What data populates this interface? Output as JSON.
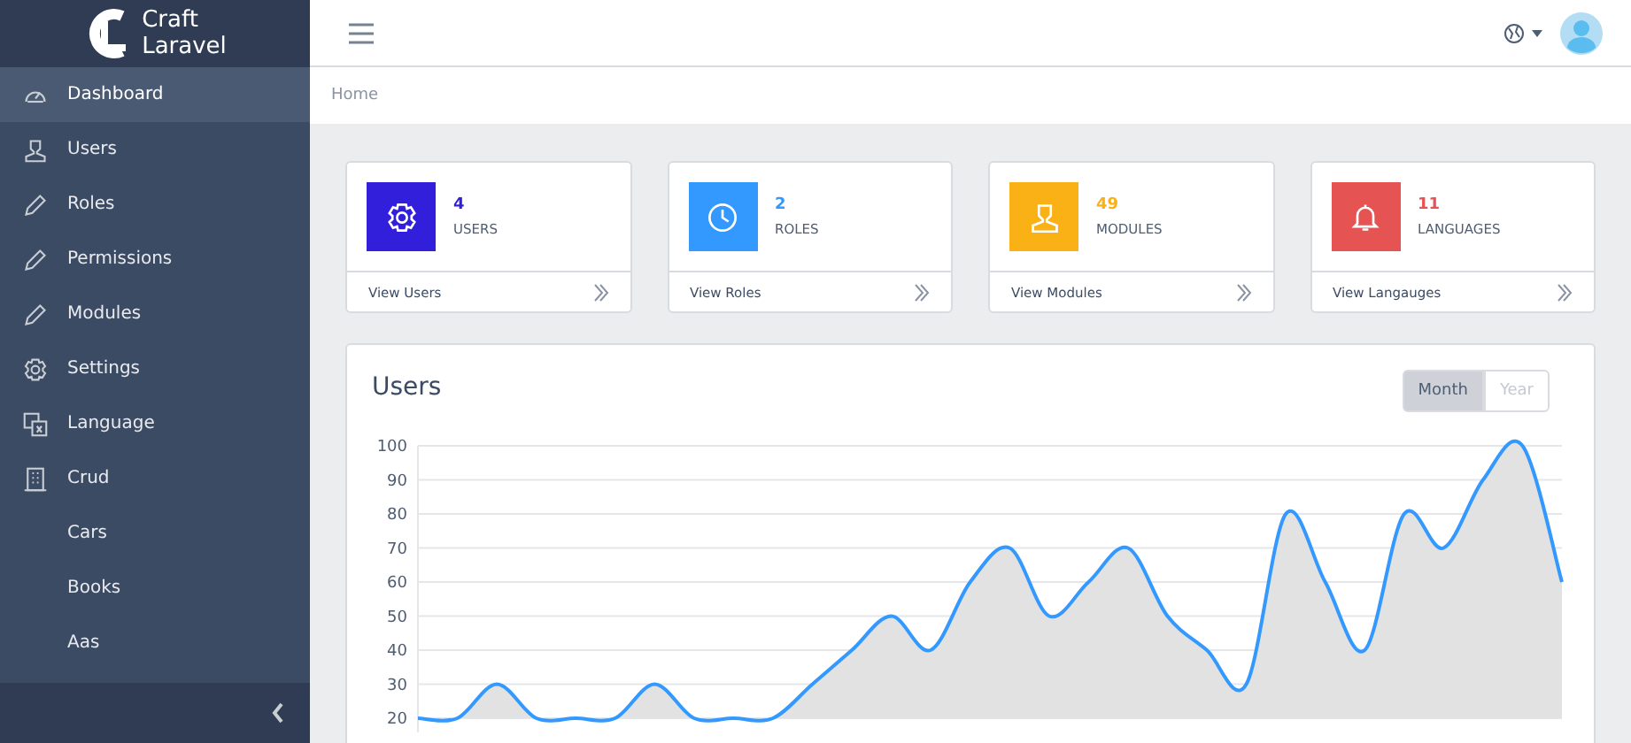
{
  "brand": {
    "line1": "Craft",
    "line2": "Laravel"
  },
  "sidebar": {
    "items": [
      {
        "label": "Dashboard",
        "selected": true
      },
      {
        "label": "Users",
        "selected": false
      },
      {
        "label": "Roles",
        "selected": false
      },
      {
        "label": "Permissions",
        "selected": false
      },
      {
        "label": "Modules",
        "selected": false
      },
      {
        "label": "Settings",
        "selected": false
      },
      {
        "label": "Language",
        "selected": false
      },
      {
        "label": "Crud",
        "selected": false
      },
      {
        "label": "Cars",
        "selected": false
      },
      {
        "label": "Books",
        "selected": false
      },
      {
        "label": "Aas",
        "selected": false
      }
    ]
  },
  "breadcrumb": "Home",
  "stats": [
    {
      "count": "4",
      "label": "USERS",
      "link": "View Users",
      "color": "#321fdb"
    },
    {
      "count": "2",
      "label": "ROLES",
      "link": "View Roles",
      "color": "#3399ff"
    },
    {
      "count": "49",
      "label": "MODULES",
      "link": "View Modules",
      "color": "#f9b115"
    },
    {
      "count": "11",
      "label": "LANGUAGES",
      "link": "View Langauges",
      "color": "#e55353"
    }
  ],
  "chart": {
    "title": "Users",
    "periods": [
      {
        "label": "Month",
        "selected": true
      },
      {
        "label": "Year",
        "selected": false
      }
    ],
    "chart_data": {
      "type": "area",
      "grid": true,
      "ylim": [
        20,
        100
      ],
      "yticks": [
        20,
        30,
        40,
        50,
        60,
        70,
        80,
        90,
        100
      ],
      "series": [
        {
          "color": "#3399ff",
          "values": [
            20,
            20,
            30,
            20,
            20,
            20,
            30,
            20,
            20,
            20,
            30,
            40,
            50,
            40,
            60,
            70,
            50,
            60,
            70,
            50,
            40,
            30,
            80,
            60,
            40,
            80,
            70,
            90,
            100,
            60
          ]
        }
      ]
    }
  }
}
